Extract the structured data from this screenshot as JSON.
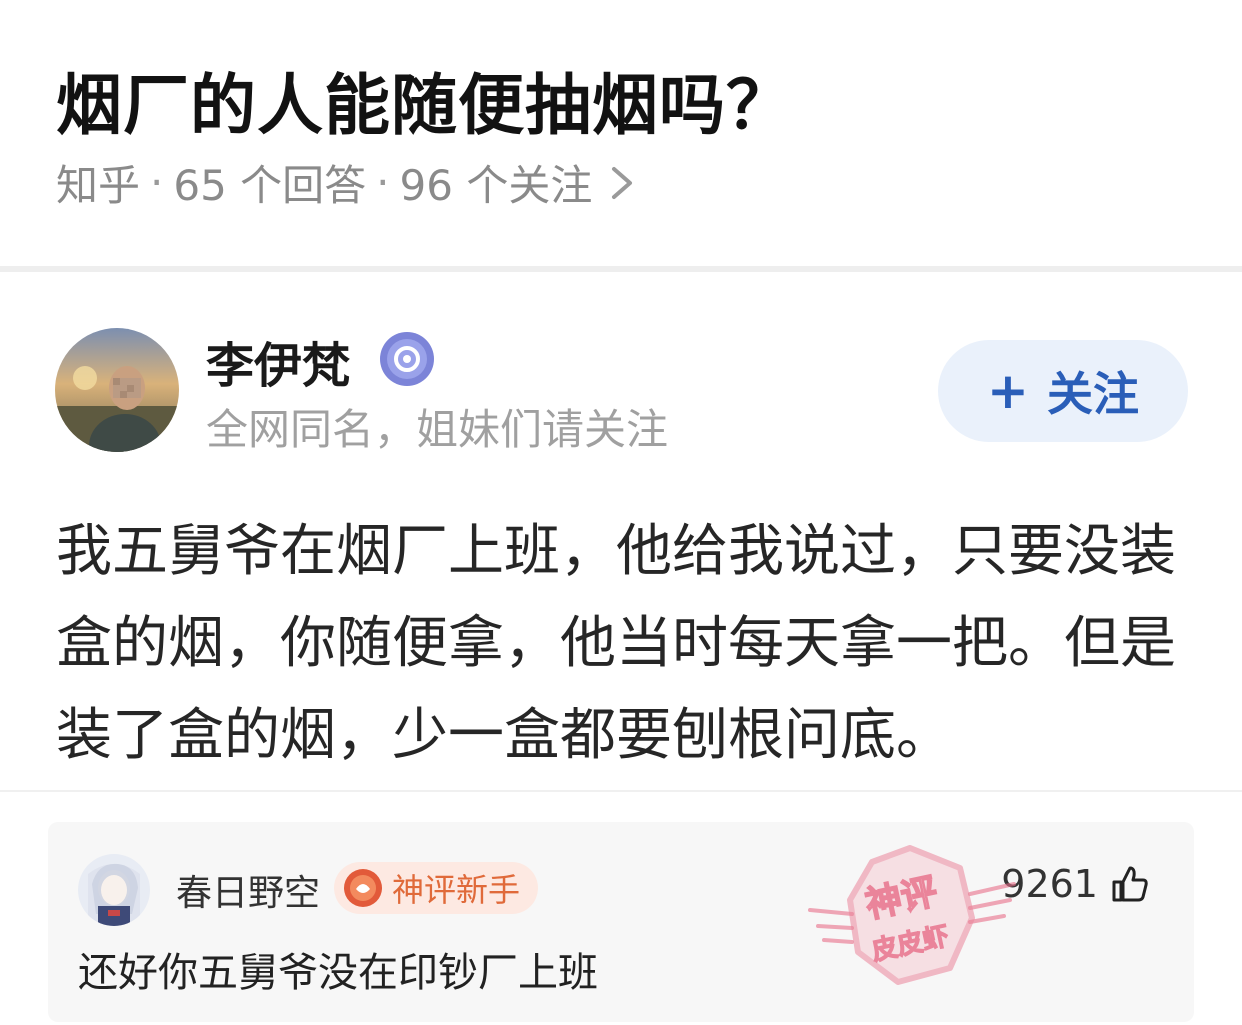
{
  "question": {
    "title": "烟厂的人能随便抽烟吗？",
    "source": "知乎",
    "answers": "65 个回答",
    "followers": "96 个关注",
    "separator": "·"
  },
  "answer": {
    "author_name": "李伊梵",
    "author_bio": "全网同名，姐妹们请关注",
    "follow_button": "关注",
    "follow_plus": "+",
    "text": "我五舅爷在烟厂上班，他给我说过，只要没装盒的烟，你随便拿，他当时每天拿一把。但是装了盒的烟，少一盒都要刨根问底。"
  },
  "comment": {
    "user": "春日野空",
    "tag": "神评新手",
    "likes": "9261",
    "text": "还好你五舅爷没在印钞厂上班"
  },
  "watermark": {
    "line1": "神评",
    "line2": "皮皮虾"
  },
  "colors": {
    "follow_text": "#2a5eb8",
    "follow_bg": "#eaf1fb",
    "tag_text": "#e06a3a",
    "tag_bg": "#fde9e2",
    "meta_gray": "#8a8a8a",
    "stamp_red": "#e8708a"
  }
}
